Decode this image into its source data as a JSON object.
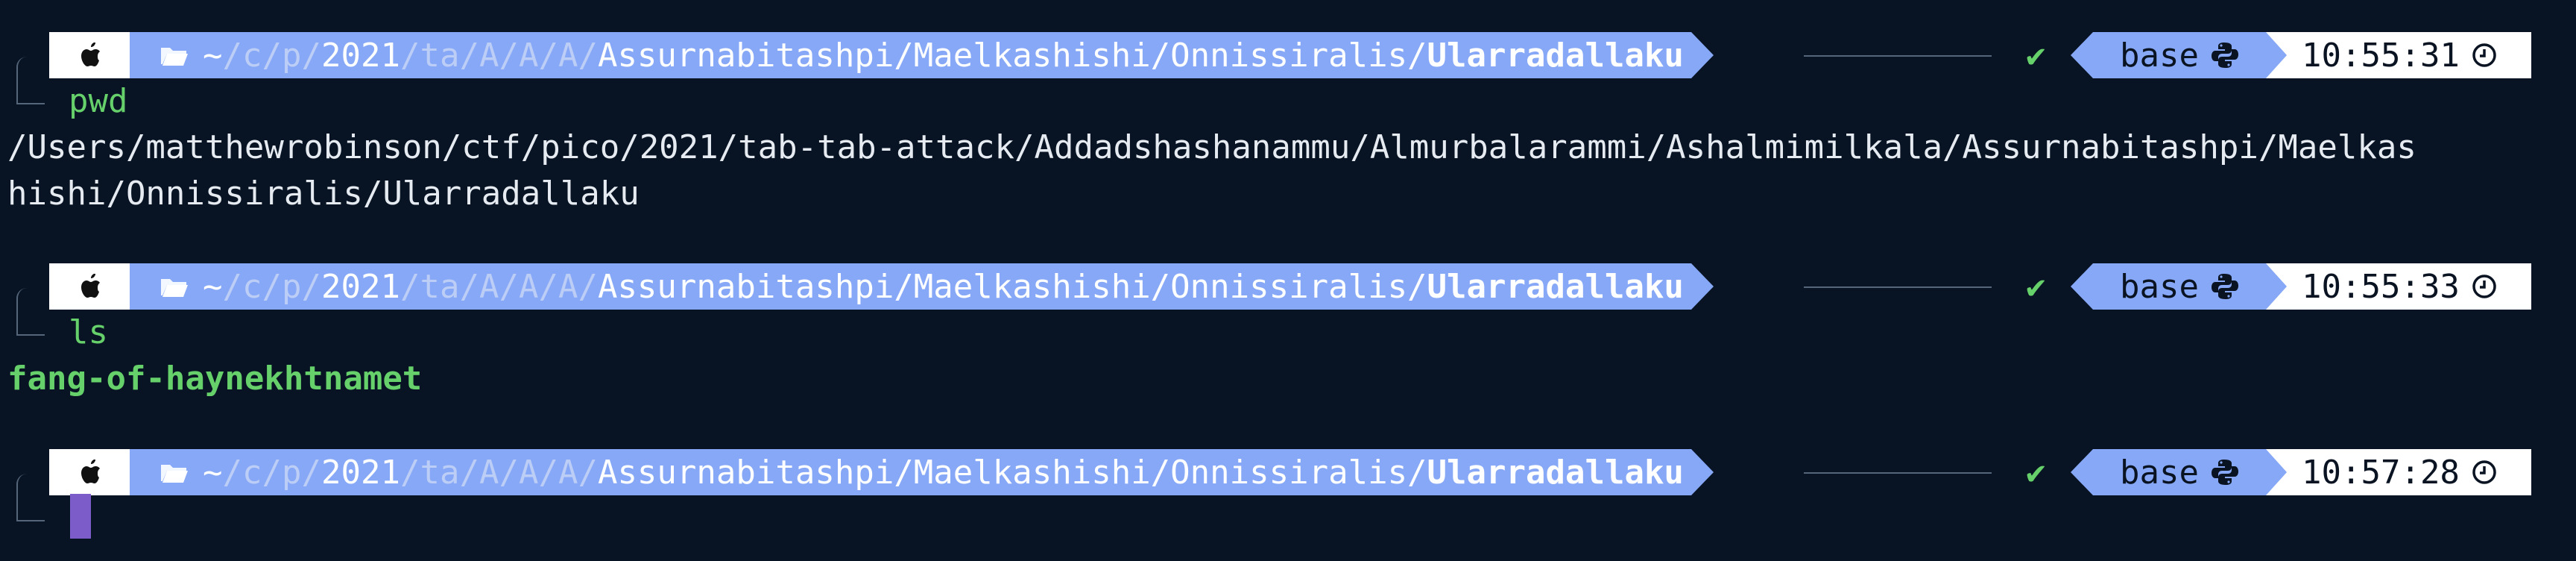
{
  "prompts": [
    {
      "path": {
        "home": "~",
        "p1": "c",
        "p2": "p",
        "p3": "2021",
        "p4": "ta",
        "p5": "A",
        "p6": "A",
        "p7": "A",
        "full": "Assurnabitashpi/Maelkashishi/Onnissiralis/",
        "current": "Ularradallaku"
      },
      "status_icon": "✔",
      "env": "base",
      "time": "10:55:31",
      "command": "pwd"
    },
    {
      "path": {
        "home": "~",
        "p1": "c",
        "p2": "p",
        "p3": "2021",
        "p4": "ta",
        "p5": "A",
        "p6": "A",
        "p7": "A",
        "full": "Assurnabitashpi/Maelkashishi/Onnissiralis/",
        "current": "Ularradallaku"
      },
      "status_icon": "✔",
      "env": "base",
      "time": "10:55:33",
      "command": "ls"
    },
    {
      "path": {
        "home": "~",
        "p1": "c",
        "p2": "p",
        "p3": "2021",
        "p4": "ta",
        "p5": "A",
        "p6": "A",
        "p7": "A",
        "full": "Assurnabitashpi/Maelkashishi/Onnissiralis/",
        "current": "Ularradallaku"
      },
      "status_icon": "✔",
      "env": "base",
      "time": "10:57:28",
      "command": ""
    }
  ],
  "outputs": {
    "pwd_line1": "/Users/matthewrobinson/ctf/pico/2021/tab-tab-attack/Addadshashanammu/Almurbalarammi/Ashalmimilkala/Assurnabitashpi/Maelkas",
    "pwd_line2": "hishi/Onnissiralis/Ularradallaku",
    "ls_entry": "fang-of-haynekhtnamet"
  },
  "icons": {
    "os": "apple-icon",
    "folder": "folder-icon",
    "env": "python-icon",
    "clock": "clock-icon"
  },
  "colors": {
    "background": "#081423",
    "segment_blue": "#87a8f7",
    "success_green": "#66d06b",
    "cursor": "#7c5cc9"
  }
}
